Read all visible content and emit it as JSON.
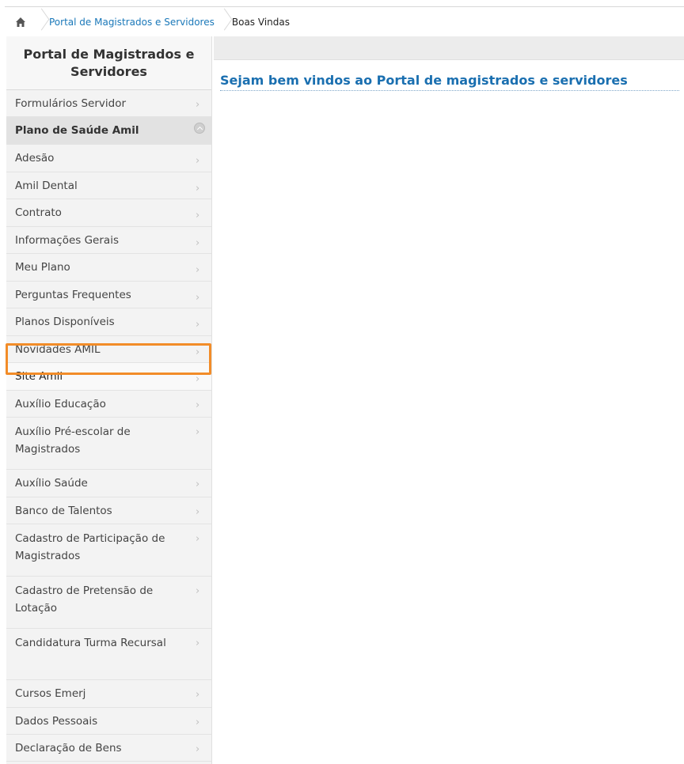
{
  "breadcrumb": {
    "home_icon": "home-icon",
    "items": [
      {
        "label": "Portal de Magistrados e Servidores"
      },
      {
        "label": "Boas Vindas"
      }
    ]
  },
  "sidebar": {
    "title": "Portal de Magistrados e Servidores",
    "items_before": [
      {
        "label": "Formulários Servidor"
      }
    ],
    "group": {
      "label": "Plano de Saúde Amil",
      "expanded": true,
      "children": [
        {
          "label": "Adesão"
        },
        {
          "label": "Amil Dental"
        },
        {
          "label": "Contrato"
        },
        {
          "label": "Informações Gerais"
        },
        {
          "label": "Meu Plano"
        },
        {
          "label": "Perguntas Frequentes"
        },
        {
          "label": "Planos Disponíveis"
        },
        {
          "label": "Novidades AMIL"
        },
        {
          "label": "Site Amil",
          "selected": true
        }
      ]
    },
    "items_after": [
      {
        "label": "Auxílio Educação"
      },
      {
        "label": "Auxílio Pré-escolar de Magistrados"
      },
      {
        "label": "Auxílio Saúde"
      },
      {
        "label": "Banco de Talentos"
      },
      {
        "label": "Cadastro de Participação de Magistrados"
      },
      {
        "label": "Cadastro de Pretensão de Lotação"
      },
      {
        "label": "Candidatura Turma Recursal"
      },
      {
        "label": "Cursos Emerj"
      },
      {
        "label": "Dados Pessoais"
      },
      {
        "label": "Declaração de Bens"
      }
    ]
  },
  "main": {
    "title": "Sejam bem vindos ao Portal de magistrados e servidores"
  },
  "colors": {
    "link": "#1a78b9",
    "highlight": "#f28c28",
    "title": "#1a6fb0"
  }
}
